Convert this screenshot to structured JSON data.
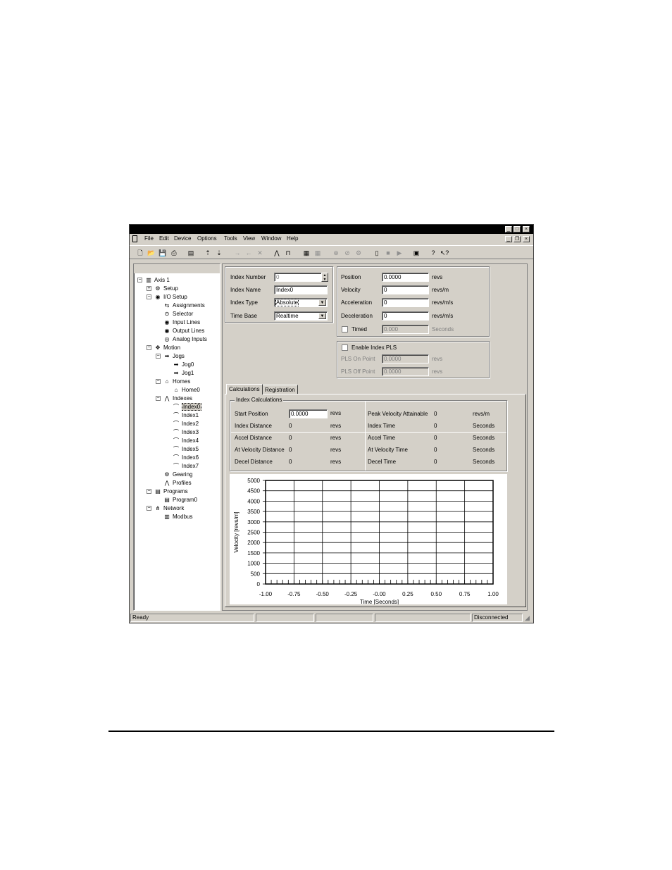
{
  "menubar": {
    "items": [
      "File",
      "Edit",
      "Device",
      "Options",
      "Tools",
      "View",
      "Window",
      "Help"
    ]
  },
  "tree": {
    "items": [
      {
        "label": "Axis 1",
        "level": 0,
        "icon": "axis-icon",
        "expander": "−"
      },
      {
        "label": "Setup",
        "level": 1,
        "icon": "setup-icon",
        "expander": "+"
      },
      {
        "label": "I/O Setup",
        "level": 1,
        "icon": "io-icon",
        "expander": "−"
      },
      {
        "label": "Assignments",
        "level": 2,
        "icon": "assignments-icon"
      },
      {
        "label": "Selector",
        "level": 2,
        "icon": "selector-icon"
      },
      {
        "label": "Input Lines",
        "level": 2,
        "icon": "input-lines-icon"
      },
      {
        "label": "Output Lines",
        "level": 2,
        "icon": "output-lines-icon"
      },
      {
        "label": "Analog Inputs",
        "level": 2,
        "icon": "analog-icon"
      },
      {
        "label": "Motion",
        "level": 1,
        "icon": "motion-icon",
        "expander": "−"
      },
      {
        "label": "Jogs",
        "level": 2,
        "icon": "jogs-icon",
        "expander": "−"
      },
      {
        "label": "Jog0",
        "level": 3,
        "icon": "jog-icon"
      },
      {
        "label": "Jog1",
        "level": 3,
        "icon": "jog-icon"
      },
      {
        "label": "Homes",
        "level": 2,
        "icon": "homes-icon",
        "expander": "−"
      },
      {
        "label": "Home0",
        "level": 3,
        "icon": "home-icon"
      },
      {
        "label": "Indexes",
        "level": 2,
        "icon": "indexes-icon",
        "expander": "−"
      },
      {
        "label": "Index0",
        "level": 3,
        "icon": "index-icon",
        "selected": true
      },
      {
        "label": "Index1",
        "level": 3,
        "icon": "index-icon"
      },
      {
        "label": "Index2",
        "level": 3,
        "icon": "index-icon"
      },
      {
        "label": "Index3",
        "level": 3,
        "icon": "index-icon"
      },
      {
        "label": "Index4",
        "level": 3,
        "icon": "index-icon"
      },
      {
        "label": "Index5",
        "level": 3,
        "icon": "index-icon"
      },
      {
        "label": "Index6",
        "level": 3,
        "icon": "index-icon"
      },
      {
        "label": "Index7",
        "level": 3,
        "icon": "index-icon"
      },
      {
        "label": "Gearing",
        "level": 2,
        "icon": "gearing-icon"
      },
      {
        "label": "Profiles",
        "level": 2,
        "icon": "profiles-icon"
      },
      {
        "label": "Programs",
        "level": 1,
        "icon": "programs-icon",
        "expander": "−"
      },
      {
        "label": "Program0",
        "level": 2,
        "icon": "program-icon"
      },
      {
        "label": "Network",
        "level": 1,
        "icon": "network-icon",
        "expander": "−"
      },
      {
        "label": "Modbus",
        "level": 2,
        "icon": "modbus-icon"
      }
    ]
  },
  "index_form": {
    "number_label": "Index Number",
    "number_value": "0",
    "name_label": "Index Name",
    "name_value": "Index0",
    "type_label": "Index Type",
    "type_value": "Absolute",
    "timebase_label": "Time Base",
    "timebase_value": "Realtime"
  },
  "motion_form": {
    "position_label": "Position",
    "position_value": "0.0000",
    "position_unit": "revs",
    "velocity_label": "Velocity",
    "velocity_value": "0",
    "velocity_unit": "revs/m",
    "accel_label": "Acceleration",
    "accel_value": "0",
    "accel_unit": "revs/m/s",
    "decel_label": "Deceleration",
    "decel_value": "0",
    "decel_unit": "revs/m/s",
    "timed_label": "Timed",
    "timed_value": "0.000",
    "timed_unit": "Seconds"
  },
  "pls": {
    "enable_label": "Enable Index PLS",
    "on_label": "PLS On Point",
    "on_value": "0.0000",
    "on_unit": "revs",
    "off_label": "PLS Off Point",
    "off_value": "0.0000",
    "off_unit": "revs"
  },
  "tabs": [
    "Calculations",
    "Registration"
  ],
  "calculations": {
    "group_title": "Index Calculations",
    "start_position_label": "Start Position",
    "start_position_value": "0.0000",
    "start_position_unit": "revs",
    "peak_velocity_label": "Peak Velocity Attainable",
    "peak_velocity_value": "0",
    "peak_velocity_unit": "revs/m",
    "index_distance_label": "Index Distance",
    "index_distance_value": "0",
    "index_distance_unit": "revs",
    "index_time_label": "Index Time",
    "index_time_value": "0",
    "index_time_unit": "Seconds",
    "accel_distance_label": "Accel Distance",
    "accel_distance_value": "0",
    "accel_distance_unit": "revs",
    "accel_time_label": "Accel Time",
    "accel_time_value": "0",
    "accel_time_unit": "Seconds",
    "atvel_distance_label": "At Velocity Distance",
    "atvel_distance_value": "0",
    "atvel_distance_unit": "revs",
    "atvel_time_label": "At Velocity Time",
    "atvel_time_value": "0",
    "atvel_time_unit": "Seconds",
    "decel_distance_label": "Decel Distance",
    "decel_distance_value": "0",
    "decel_distance_unit": "revs",
    "decel_time_label": "Decel Time",
    "decel_time_value": "0",
    "decel_time_unit": "Seconds"
  },
  "chart_data": {
    "type": "line",
    "title": "",
    "xlabel": "Time [Seconds]",
    "ylabel": "Velocity [revs/m]",
    "xlim": [
      -1.0,
      1.0
    ],
    "ylim": [
      0,
      5000
    ],
    "x_ticks": [
      "-1.00",
      "-0.75",
      "-0.50",
      "-0.25",
      "-0.00",
      "0.25",
      "0.50",
      "0.75",
      "1.00"
    ],
    "y_ticks": [
      "0",
      "500",
      "1000",
      "1500",
      "2000",
      "2500",
      "3000",
      "3500",
      "4000",
      "4500",
      "5000"
    ],
    "grid": true,
    "series": []
  },
  "status": {
    "left": "Ready",
    "right": "Disconnected"
  }
}
